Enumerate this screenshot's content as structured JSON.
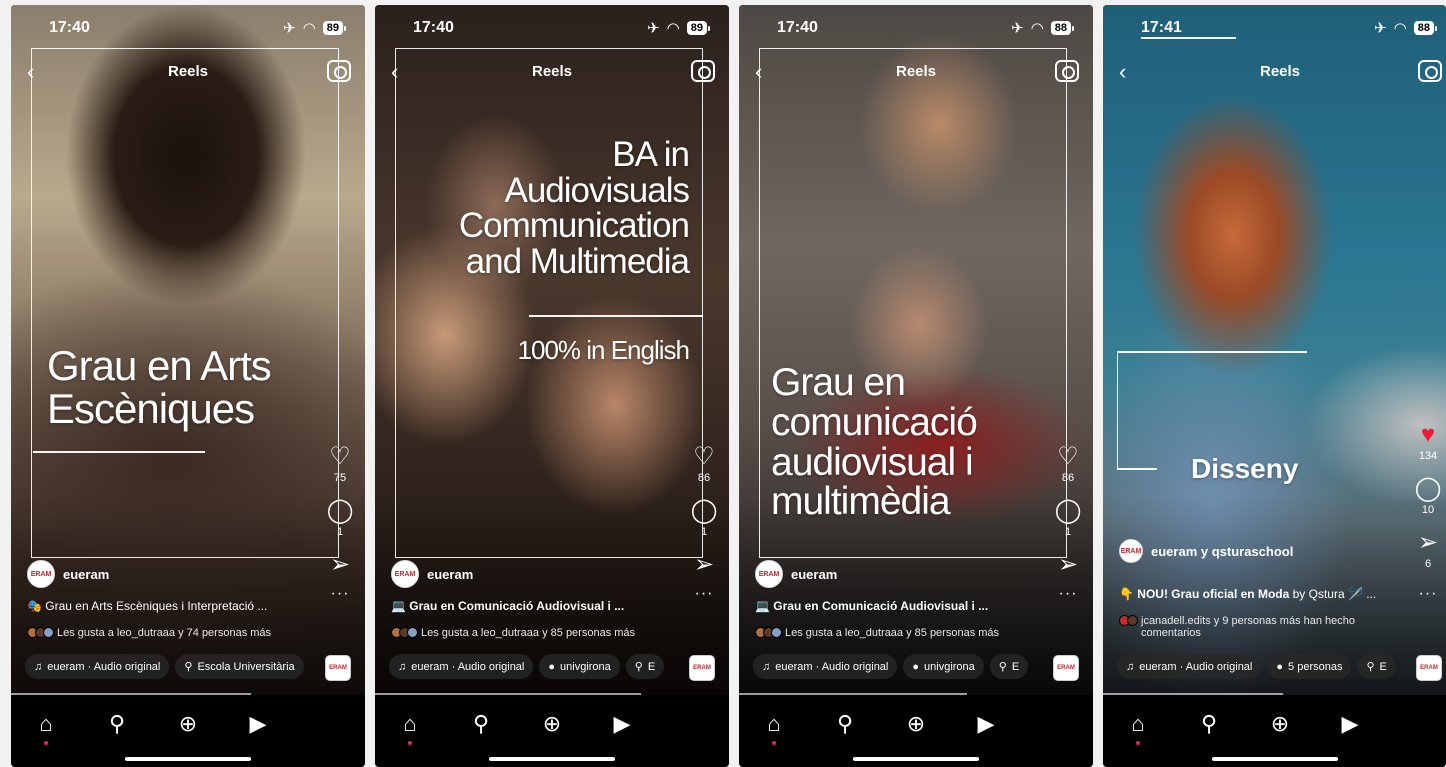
{
  "screens": [
    {
      "time": "17:40",
      "battery": "89",
      "header_title": "Reels",
      "overlay_text": "Grau en Arts\nEscèniques",
      "likes_count": "75",
      "comments_count": "1",
      "username": "eueram",
      "avatar_label": "ERAM",
      "caption": "🎭 Grau en Arts Escèniques i Interpretació ...",
      "likes_line": "Les gusta a leo_dutraaa y 74 personas más",
      "chip_audio": "eueram · Audio original",
      "chip_second": "Escola Universitària",
      "chip_third": ""
    },
    {
      "time": "17:40",
      "battery": "89",
      "header_title": "Reels",
      "overlay_text": "BA in\nAudiovisuals\nCommunication\nand Multimedia",
      "overlay_sub": "100% in English",
      "likes_count": "86",
      "comments_count": "1",
      "username": "eueram",
      "avatar_label": "ERAM",
      "caption": "💻 Grau en Comunicació Audiovisual i ...",
      "likes_line": "Les gusta a leo_dutraaa y 85 personas más",
      "chip_audio": "eueram · Audio original",
      "chip_second": "univgirona",
      "chip_third": "E"
    },
    {
      "time": "17:40",
      "battery": "88",
      "header_title": "Reels",
      "overlay_text": "Grau en\ncomunicació\naudiovisual i\nmultimèdia",
      "likes_count": "86",
      "comments_count": "1",
      "username": "eueram",
      "avatar_label": "ERAM",
      "caption": "💻 Grau en Comunicació Audiovisual i ...",
      "likes_line": "Les gusta a leo_dutraaa y 85 personas más",
      "chip_audio": "eueram · Audio original",
      "chip_second": "univgirona",
      "chip_third": "E"
    },
    {
      "time": "17:41",
      "battery": "88",
      "header_title": "Reels",
      "overlay_text": "Disseny",
      "likes_count": "134",
      "comments_count": "10",
      "shares_count": "6",
      "username": "eueram y qsturaschool",
      "avatar_label": "ERAM",
      "caption_bold": "👇 NOU! Grau oficial en Moda",
      "caption_rest": " by Qstura 🪡 ...",
      "likes_line": "jcanadell.edits y 9 personas más han hecho comentarios",
      "chip_audio": "eueram · Audio original",
      "chip_second": "5 personas",
      "chip_third": "E"
    }
  ],
  "colors": {
    "accent_red": "#ed1c3a",
    "background": "#000000"
  },
  "icons": [
    "back-chevron-icon",
    "camera-icon",
    "heart-icon",
    "comment-icon",
    "share-icon",
    "more-icon",
    "music-note-icon",
    "location-pin-icon",
    "person-icon",
    "home-icon",
    "search-icon",
    "create-icon",
    "reels-icon"
  ]
}
